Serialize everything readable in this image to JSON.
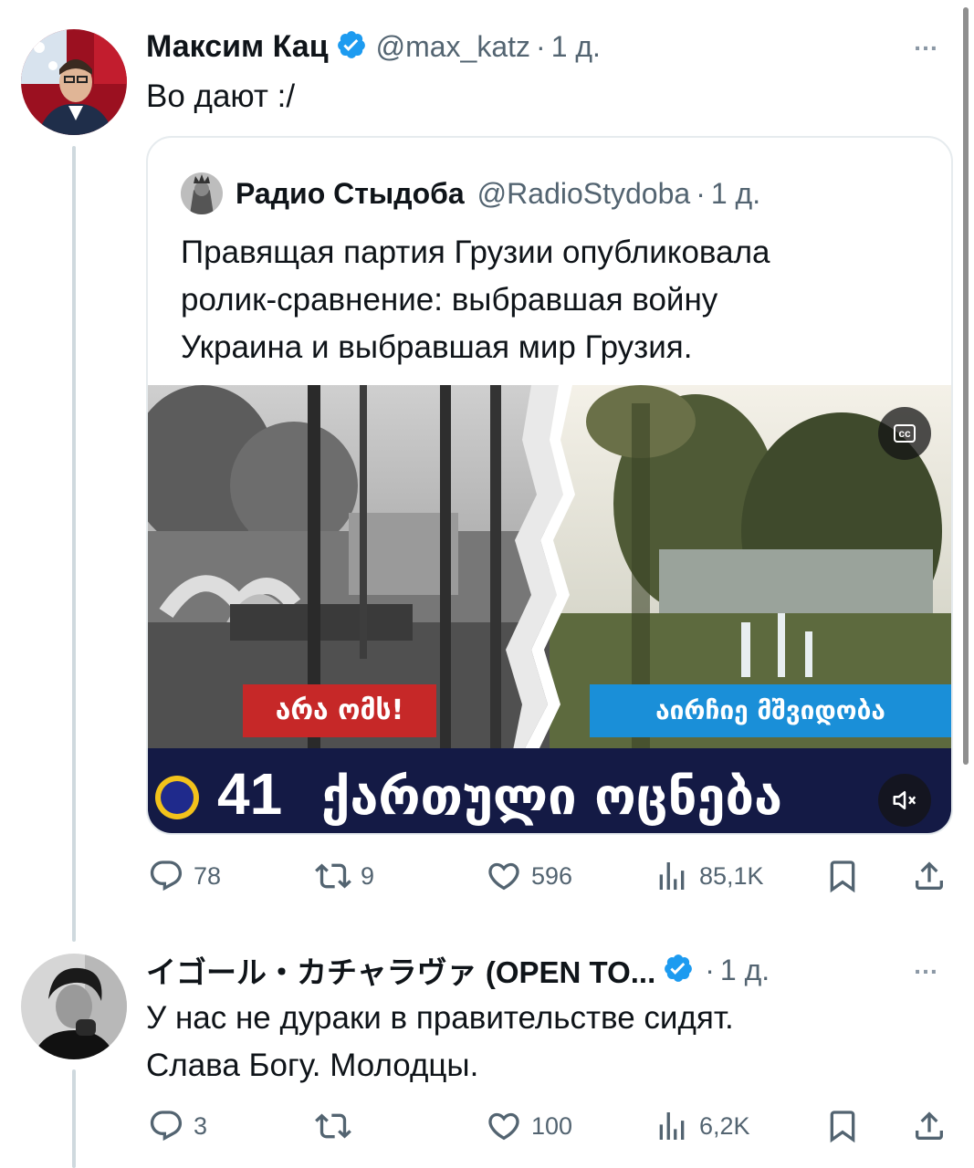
{
  "tweet1": {
    "display_name": "Максим Кац",
    "handle": "@max_katz",
    "sep": "·",
    "time": "1 д.",
    "text": "Во дают :/",
    "stats": {
      "replies": "78",
      "retweets": "9",
      "likes": "596",
      "views": "85,1K"
    }
  },
  "quote": {
    "display_name": "Радио Стыдоба",
    "handle": "@RadioStydoba",
    "sep": "·",
    "time": "1 д.",
    "text_lines": [
      "Правящая партия Грузии опубликовала",
      "ролик-сравнение: выбравшая войну",
      "Украина и выбравшая мир Грузия."
    ],
    "video": {
      "label_left": "არა ომს!",
      "label_right": "აირჩიე მშვიდობა",
      "banner_number": "41",
      "banner_text": "ქართული ოცნება",
      "cc": "cc"
    }
  },
  "tweet2": {
    "display_name": "イゴール・カチャラヴァ (OPEN TO...",
    "sep": "·",
    "time": "1 д.",
    "text_lines": [
      "У нас не дураки в правительстве сидят.",
      "Слава Богу. Молодцы."
    ],
    "stats": {
      "replies": "3",
      "retweets": "",
      "likes": "100",
      "views": "6,2K"
    }
  },
  "more_icon": "…",
  "colors": {
    "verified": "#1d9bf0",
    "label_red": "#c62828",
    "label_blue": "#1a8fd8",
    "banner": "#141a45",
    "banner_circle": "#f2c21b"
  }
}
